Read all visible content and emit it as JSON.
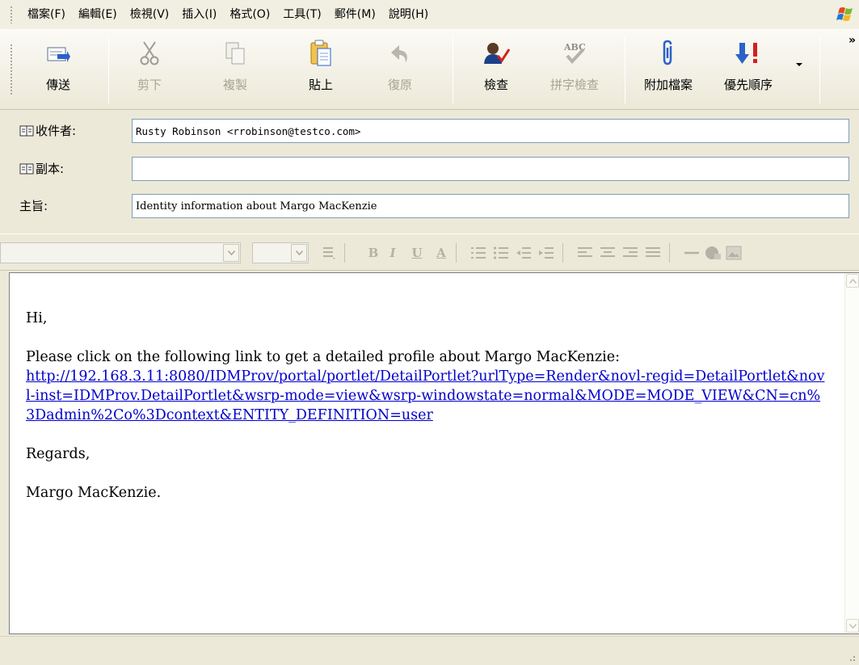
{
  "menu": {
    "items": [
      "檔案(F)",
      "編輯(E)",
      "檢視(V)",
      "插入(I)",
      "格式(O)",
      "工具(T)",
      "郵件(M)",
      "說明(H)"
    ]
  },
  "toolbar": {
    "send_label": "傳送",
    "cut_label": "剪下",
    "copy_label": "複製",
    "paste_label": "貼上",
    "undo_label": "復原",
    "check_label": "檢查",
    "spell_label": "拼字檢查",
    "attach_label": "附加檔案",
    "priority_label": "優先順序",
    "overflow": "»",
    "priority_color": "#d42020",
    "arrow_color": "#2a62c9"
  },
  "header": {
    "to_label": "收件者:",
    "to_value": "Rusty Robinson <rrobinson@testco.com>",
    "cc_label": "副本:",
    "cc_value": "",
    "subject_label": "主旨:",
    "subject_value": "Identity information about Margo MacKenzie"
  },
  "body": {
    "greeting": "Hi,",
    "intro": "Please click on the following link to get a detailed profile about Margo MacKenzie:",
    "link": "http://192.168.3.11:8080/IDMProv/portal/portlet/DetailPortlet?urlType=Render&novl-regid=DetailPortlet&novl-inst=IDMProv.DetailPortlet&wsrp-mode=view&wsrp-windowstate=normal&MODE=MODE_VIEW&CN=cn%3Dadmin%2Co%3Dcontext&ENTITY_DEFINITION=user",
    "closing": "Regards,",
    "signature": "Margo MacKenzie.",
    "link_color": "#0000cc"
  }
}
